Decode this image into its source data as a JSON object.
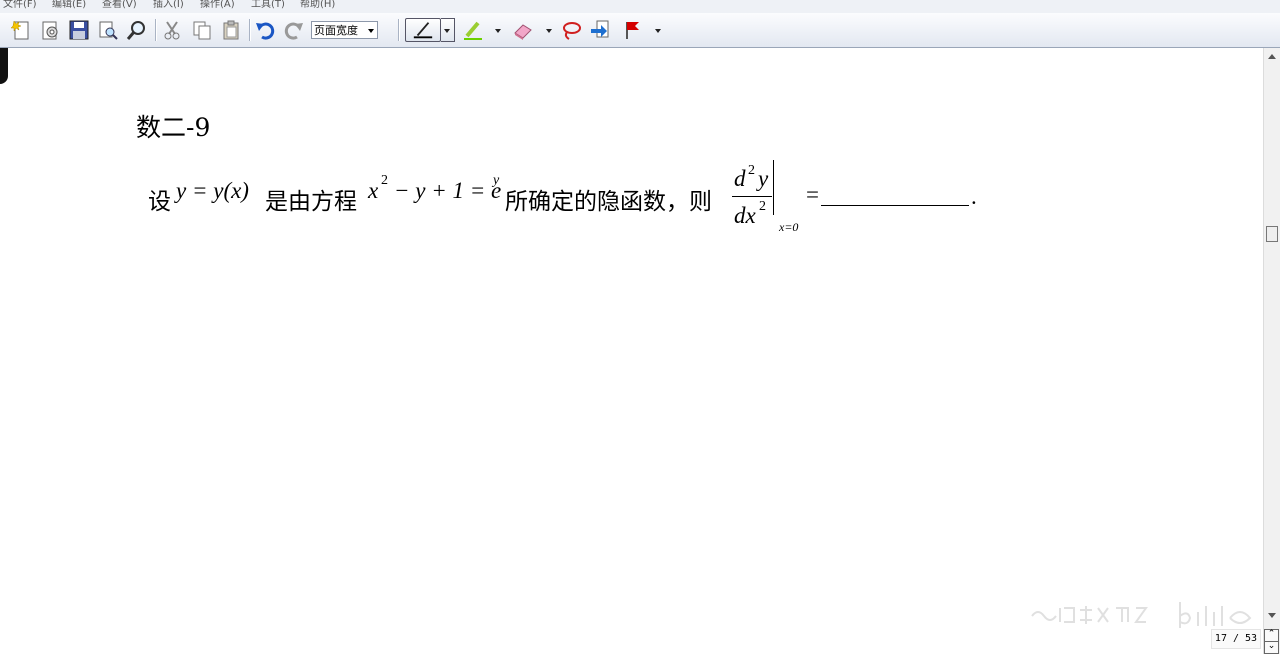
{
  "menu": {
    "items": [
      {
        "label": "文件(F)"
      },
      {
        "label": "编辑(E)"
      },
      {
        "label": "查看(V)"
      },
      {
        "label": "插入(I)"
      },
      {
        "label": "操作(A)"
      },
      {
        "label": "工具(T)"
      },
      {
        "label": "帮助(H)"
      }
    ]
  },
  "toolbar": {
    "zoom_value": "页面宽度",
    "icons": [
      "new-page-icon",
      "page-setup-icon",
      "save-icon",
      "print-preview-icon",
      "find-icon",
      "cut-icon",
      "copy-icon",
      "paste-icon",
      "undo-icon",
      "redo-icon",
      "pen-icon",
      "highlighter-icon",
      "eraser-icon",
      "lasso-icon",
      "insert-space-icon",
      "flag-icon"
    ]
  },
  "document": {
    "title": "数二-9",
    "question": {
      "prefix": "设",
      "func": "y = y(x)",
      "text1": "是由方程",
      "eq_x": "x",
      "eq_x_exp": "2",
      "eq_mid": "− y + 1 = e",
      "eq_e_exp": "y",
      "text2": "所确定的隐函数，则",
      "num_d": "d",
      "num_exp": "2",
      "num_y": "y",
      "den_dx": "dx",
      "den_exp": "2",
      "eval_at": "x=0",
      "equals": "=",
      "period": "."
    }
  },
  "status": {
    "page_indicator": "17 / 53"
  },
  "colors": {
    "toolbar_bg": "#e3e8f1",
    "flag": "#d40000",
    "save_icon": "#3a4fa0",
    "undo": "#1a56c4"
  }
}
